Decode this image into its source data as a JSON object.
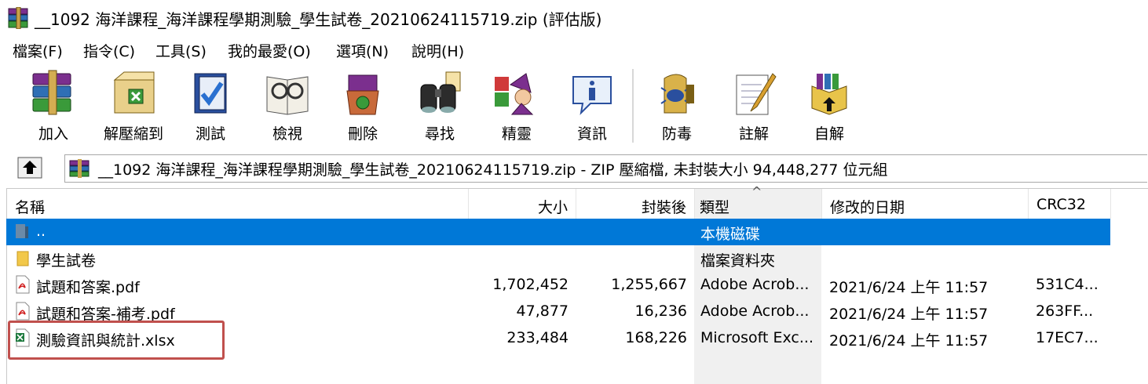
{
  "window": {
    "title": "__1092 海洋課程_海洋課程學期測驗_學生試卷_20210624115719.zip (評估版)"
  },
  "menu": [
    {
      "label": "檔案(F)"
    },
    {
      "label": "指令(C)"
    },
    {
      "label": "工具(S)"
    },
    {
      "label": "我的最愛(O)"
    },
    {
      "label": "選項(N)"
    },
    {
      "label": "說明(H)"
    }
  ],
  "toolbar": [
    {
      "label": "加入",
      "icon": "add-archive-icon"
    },
    {
      "label": "解壓縮到",
      "icon": "extract-to-icon"
    },
    {
      "label": "測試",
      "icon": "test-icon"
    },
    {
      "label": "檢視",
      "icon": "view-icon"
    },
    {
      "label": "刪除",
      "icon": "delete-icon"
    },
    {
      "label": "尋找",
      "icon": "find-icon"
    },
    {
      "label": "精靈",
      "icon": "wizard-icon"
    },
    {
      "label": "資訊",
      "icon": "info-icon"
    },
    {
      "label": "防毒",
      "icon": "antivirus-icon"
    },
    {
      "label": "註解",
      "icon": "comment-icon"
    },
    {
      "label": "自解",
      "icon": "sfx-icon"
    }
  ],
  "address": {
    "text": "__1092 海洋課程_海洋課程學期測驗_學生試卷_20210624115719.zip - ZIP 壓縮檔, 未封裝大小 94,448,277 位元組"
  },
  "columns": {
    "name": "名稱",
    "size": "大小",
    "packed": "封裝後",
    "type": "類型",
    "modified": "修改的日期",
    "crc": "CRC32",
    "sort_indicator": "^"
  },
  "rows": [
    {
      "name": "..",
      "size": "",
      "packed": "",
      "type": "本機磁碟",
      "modified": "",
      "crc": "",
      "icon": "parent-folder-icon",
      "selected": true
    },
    {
      "name": "學生試卷",
      "size": "",
      "packed": "",
      "type": "檔案資料夾",
      "modified": "",
      "crc": "",
      "icon": "folder-icon",
      "selected": false
    },
    {
      "name": "試題和答案.pdf",
      "size": "1,702,452",
      "packed": "1,255,667",
      "type": "Adobe Acrob...",
      "modified": "2021/6/24 上午 11:57",
      "crc": "531C4...",
      "icon": "pdf-file-icon",
      "selected": false
    },
    {
      "name": "試題和答案-補考.pdf",
      "size": "47,877",
      "packed": "16,236",
      "type": "Adobe Acrob...",
      "modified": "2021/6/24 上午 11:57",
      "crc": "263FF...",
      "icon": "pdf-file-icon",
      "selected": false
    },
    {
      "name": "測驗資訊與統計.xlsx",
      "size": "233,484",
      "packed": "168,226",
      "type": "Microsoft Exc...",
      "modified": "2021/6/24 上午 11:57",
      "crc": "17EC7...",
      "icon": "excel-file-icon",
      "selected": false
    }
  ],
  "colors": {
    "selection": "#0078d7",
    "highlight_box": "#c0504d",
    "type_column_bg": "#f0f0f0"
  }
}
